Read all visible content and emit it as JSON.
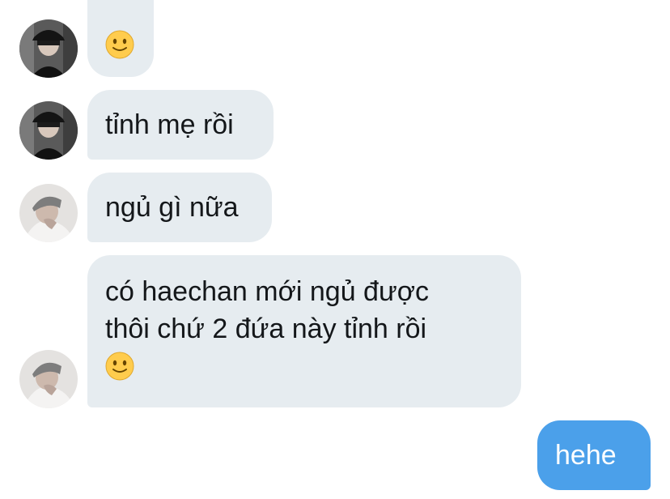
{
  "conversation": {
    "messages": [
      {
        "sender": "other",
        "avatar": "user-a",
        "emoji": "slightly-smiling-face"
      },
      {
        "sender": "other",
        "avatar": "user-a",
        "text": "tỉnh mẹ rồi"
      },
      {
        "sender": "other",
        "avatar": "user-b",
        "text": "ngủ gì nữa"
      },
      {
        "sender": "other",
        "avatar": "user-b",
        "lines": [
          "có haechan mới ngủ được",
          "thôi chứ 2 đứa này tỉnh rồi"
        ],
        "emoji": "slightly-smiling-face"
      },
      {
        "sender": "self",
        "text": "hehe"
      }
    ]
  },
  "colors": {
    "incoming_bubble": "#e6ecf0",
    "outgoing_bubble": "#4ba0ea",
    "text": "#14171a",
    "outgoing_text": "#ffffff"
  }
}
